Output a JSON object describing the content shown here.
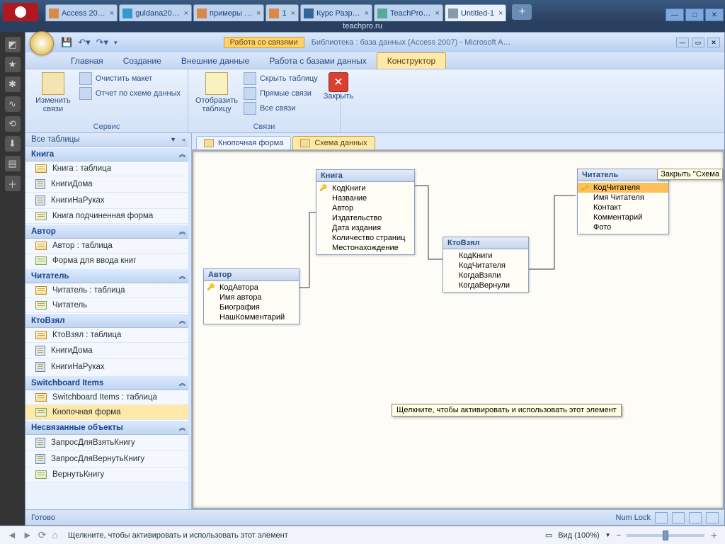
{
  "browser": {
    "address": "teachpro.ru",
    "tabs": [
      {
        "label": "Access 20…",
        "fav": "#d84"
      },
      {
        "label": "guldana20…",
        "fav": "#39c"
      },
      {
        "label": "примеры …",
        "fav": "#d84"
      },
      {
        "label": "1",
        "fav": "#d84"
      },
      {
        "label": "Курс Разр…",
        "fav": "#369"
      },
      {
        "label": "TeachPro…",
        "fav": "#5a9"
      },
      {
        "label": "Untitled-1",
        "fav": "#89a",
        "active": true
      }
    ],
    "status_tip": "Щелкните, чтобы активировать и использовать этот элемент",
    "view_label": "Вид (100%)"
  },
  "access": {
    "context_tab": "Работа со связями",
    "title_suffix": "Библиотека : база данных (Access 2007)  -  Microsoft A…",
    "ribbon_tabs": [
      "Главная",
      "Создание",
      "Внешние данные",
      "Работа с базами данных",
      "Конструктор"
    ],
    "active_ribbon_tab": 4,
    "ribbon": {
      "service_group": "Сервис",
      "edit_relations": "Изменить\nсвязи",
      "clear_layout": "Очистить макет",
      "schema_report": "Отчет по схеме данных",
      "show_table": "Отобразить\nтаблицу",
      "hide_table": "Скрыть таблицу",
      "direct_links": "Прямые связи",
      "all_links": "Все связи",
      "links_group": "Связи",
      "close": "Закрыть"
    },
    "nav": {
      "header": "Все таблицы",
      "groups": [
        {
          "name": "Книга",
          "items": [
            {
              "label": "Книга : таблица",
              "type": "table"
            },
            {
              "label": "КнигиДома",
              "type": "query"
            },
            {
              "label": "КнигиНаРуках",
              "type": "query"
            },
            {
              "label": "Книга подчиненная форма",
              "type": "form"
            }
          ]
        },
        {
          "name": "Автор",
          "items": [
            {
              "label": "Автор : таблица",
              "type": "table"
            },
            {
              "label": "Форма для ввода книг",
              "type": "form"
            }
          ]
        },
        {
          "name": "Читатель",
          "items": [
            {
              "label": "Читатель : таблица",
              "type": "table"
            },
            {
              "label": "Читатель",
              "type": "form"
            }
          ]
        },
        {
          "name": "КтоВзял",
          "items": [
            {
              "label": "КтоВзял : таблица",
              "type": "table"
            },
            {
              "label": "КнигиДома",
              "type": "query"
            },
            {
              "label": "КнигиНаРуках",
              "type": "query"
            }
          ]
        },
        {
          "name": "Switchboard Items",
          "items": [
            {
              "label": "Switchboard Items : таблица",
              "type": "table"
            },
            {
              "label": "Кнопочная форма",
              "type": "form",
              "selected": true
            }
          ]
        },
        {
          "name": "Несвязанные объекты",
          "items": [
            {
              "label": "ЗапросДляВзятьКнигу",
              "type": "query"
            },
            {
              "label": "ЗапросДляВернутьКнигу",
              "type": "query"
            },
            {
              "label": "ВернутьКнигу",
              "type": "form"
            }
          ]
        }
      ]
    },
    "doc_tabs": [
      {
        "label": "Кнопочная форма"
      },
      {
        "label": "Схема данных",
        "active": true
      }
    ],
    "tables": {
      "avtor": {
        "title": "Автор",
        "fields": [
          "КодАвтора",
          "Имя автора",
          "Биография",
          "НашКомментарий"
        ],
        "keys": [
          0
        ],
        "pos": [
          14,
          165,
          136
        ]
      },
      "kniga": {
        "title": "Книга",
        "fields": [
          "КодКниги",
          "Название",
          "Автор",
          "Издательство",
          "Дата издания",
          "Количество страниц",
          "Местонахождение"
        ],
        "keys": [
          0
        ],
        "pos": [
          173,
          25,
          140
        ]
      },
      "kto": {
        "title": "КтоВзял",
        "fields": [
          "КодКниги",
          "КодЧитателя",
          "КогдаВзяли",
          "КогдаВернули"
        ],
        "keys": [],
        "pos": [
          352,
          120,
          122
        ]
      },
      "chit": {
        "title": "Читатель",
        "fields": [
          "КодЧитателя",
          "Имя Читателя",
          "Контакт",
          "Комментарий",
          "Фото"
        ],
        "keys": [
          0
        ],
        "hl": [
          0
        ],
        "pos": [
          542,
          24,
          130
        ]
      }
    },
    "close_tip": "Закрыть ''Схема",
    "canvas_tip": "Щелкните, чтобы активировать и использовать этот элемент",
    "status": {
      "left": "Готово",
      "caps": "Num Lock"
    }
  }
}
